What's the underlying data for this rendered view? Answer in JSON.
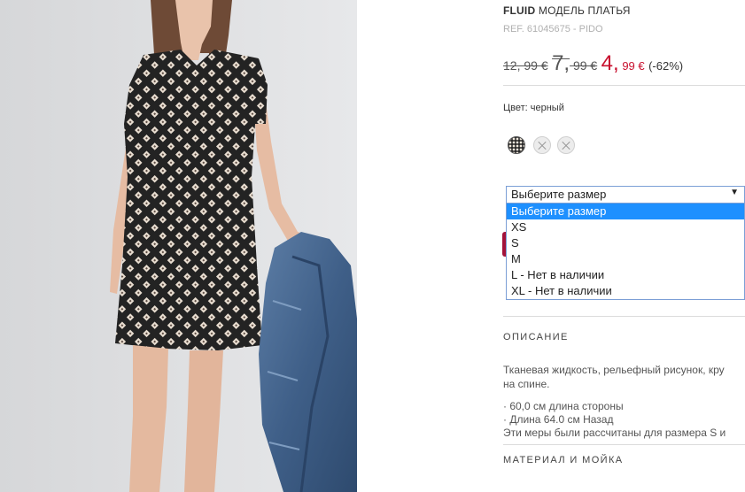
{
  "product": {
    "brand": "FLUID",
    "model_label": "МОДЕЛЬ ПЛАТЬЯ",
    "ref": "REF. 61045675 - PIDO"
  },
  "pricing": {
    "original_price": "12, 99 €",
    "previous_price_main": "7,",
    "previous_price_cents": "99 €",
    "sale_price_main": "4,",
    "sale_price_cents": "99 €",
    "discount": "(-62%)"
  },
  "color": {
    "label": "Цвет: черный",
    "swatches": [
      {
        "name": "black-print",
        "available": true
      },
      {
        "name": "unavailable",
        "available": false
      },
      {
        "name": "unavailable",
        "available": false
      }
    ]
  },
  "size_select": {
    "value": "Выберите размер",
    "options": [
      "Выберите размер",
      "XS",
      "S",
      "M",
      "L - Нет в наличии",
      "XL - Нет в наличии"
    ],
    "selected_index": 0
  },
  "description": {
    "heading": "ОПИСАНИЕ",
    "text_line1": "Тканевая жидкость, рельефный рисунок, кру",
    "text_line2": "на спине.",
    "measure1": "· 60,0 см длина стороны",
    "measure2": "· Длина 64.0 см Назад",
    "measure_note": "Эти меры были рассчитаны для размера S и"
  },
  "materials": {
    "heading": "МАТЕРИАЛ И МОЙКА"
  },
  "colors": {
    "sale_red": "#c8102e",
    "select_highlight": "#1e90ff",
    "dress_base": "#2a2a2a"
  }
}
